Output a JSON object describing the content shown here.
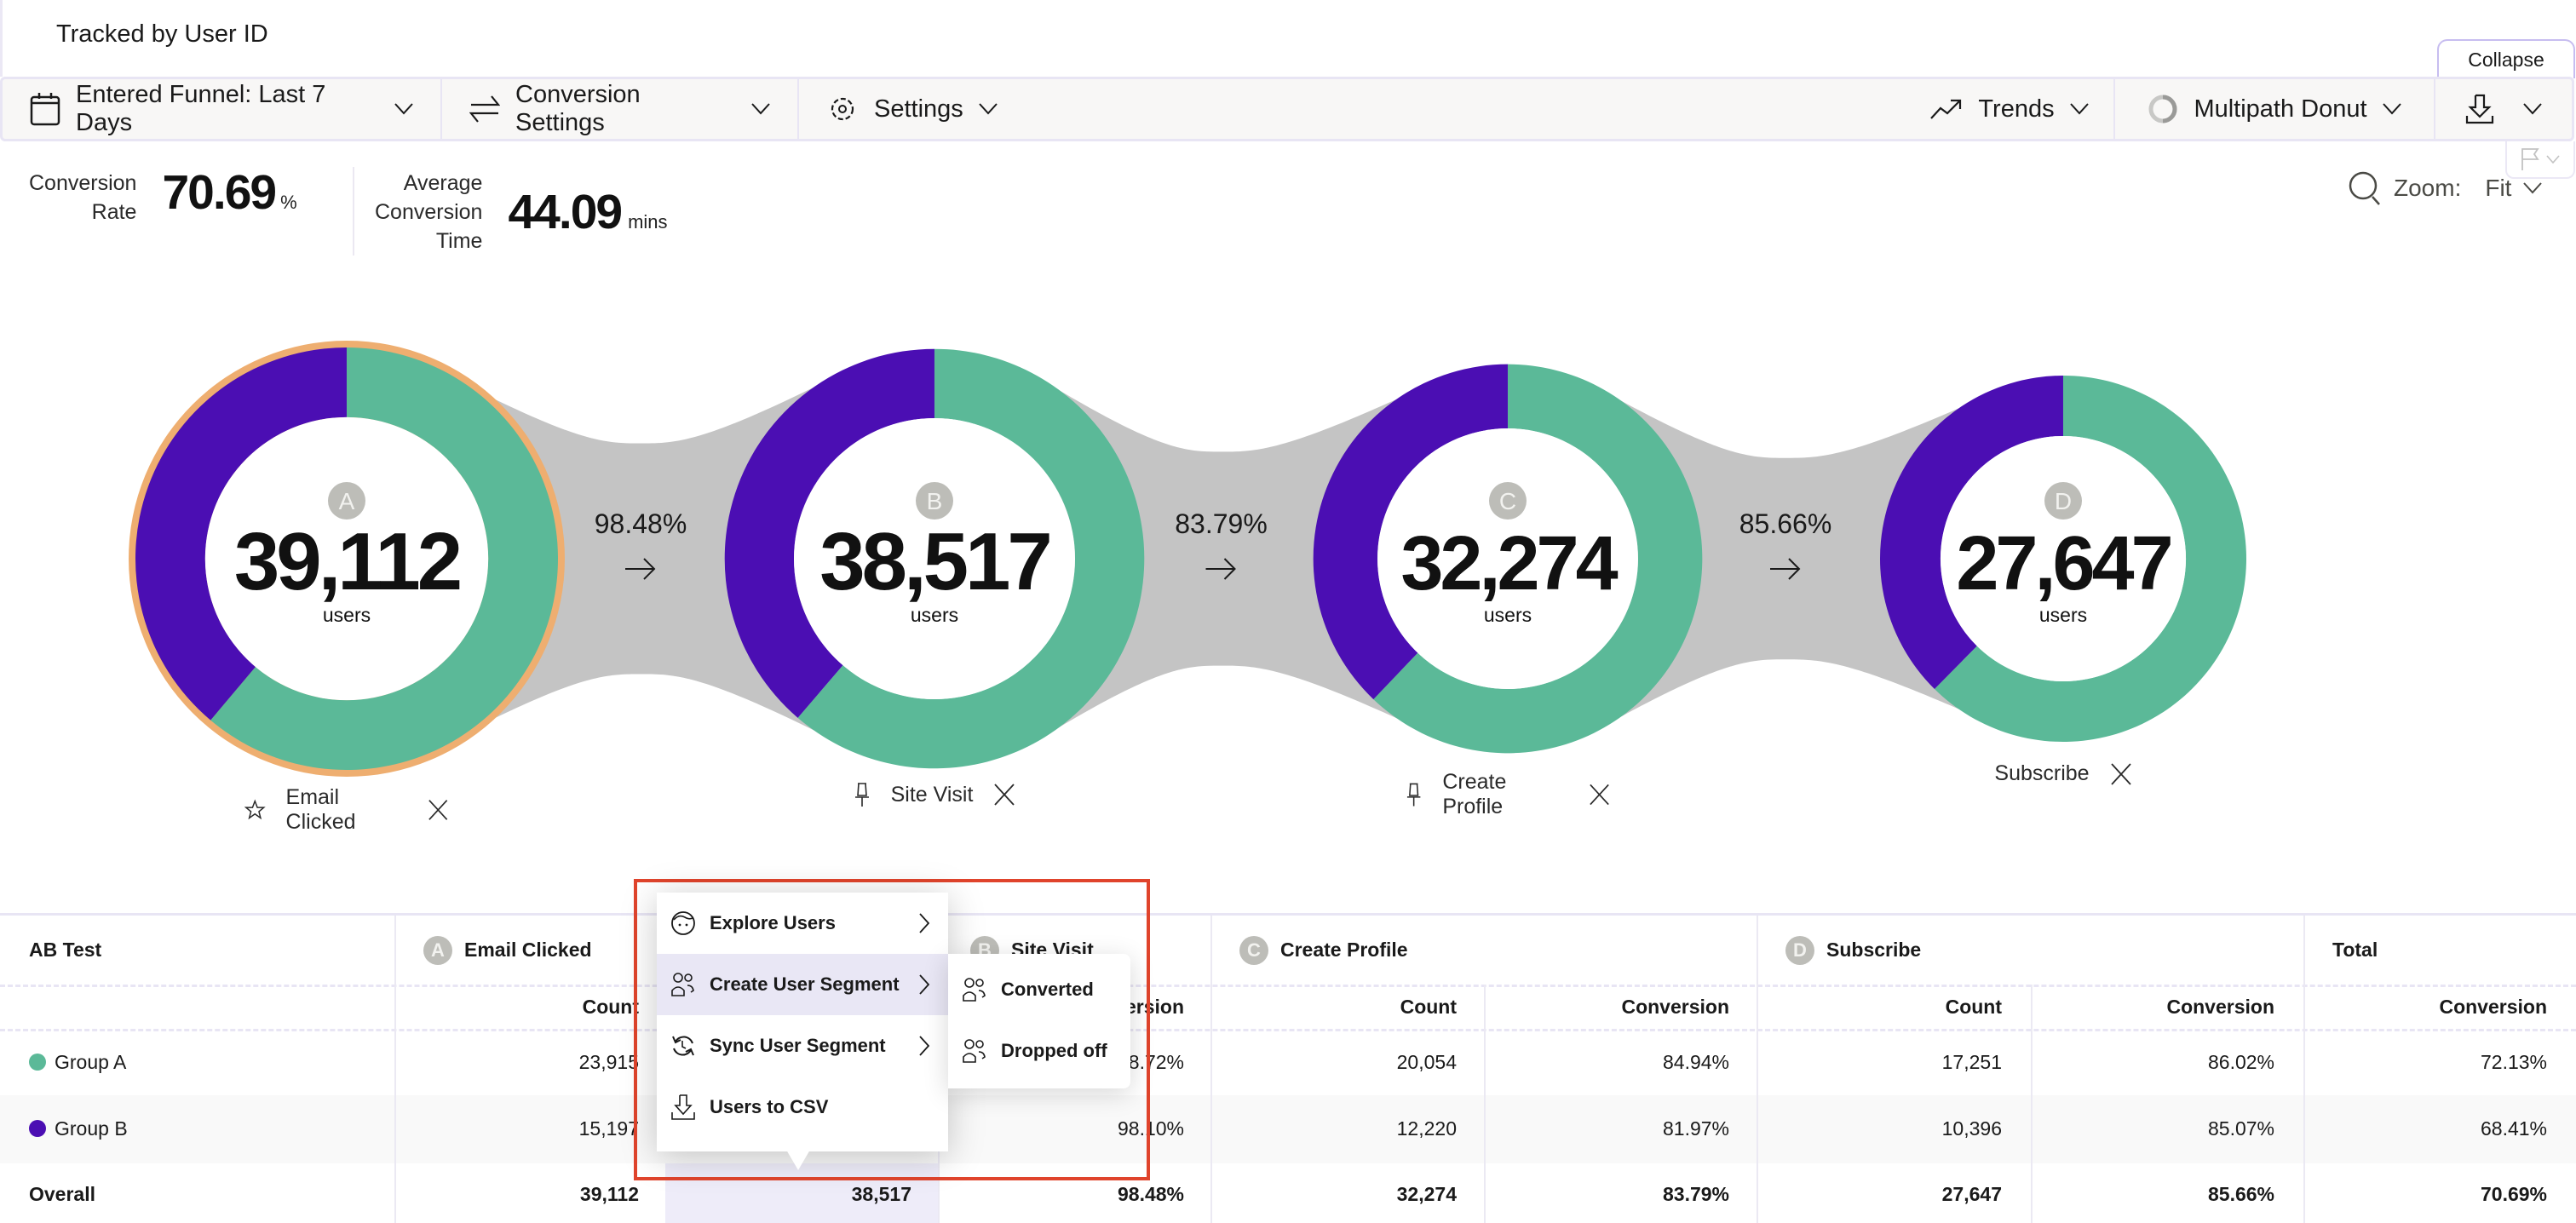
{
  "header": {
    "title": "Tracked by User ID",
    "collapse_label": "Collapse"
  },
  "toolbar": {
    "date_range": "Entered Funnel: Last 7 Days",
    "conversion_settings": "Conversion Settings",
    "settings": "Settings",
    "trends": "Trends",
    "chart_type": "Multipath Donut"
  },
  "stats": {
    "conversion_rate_label_1": "Conversion",
    "conversion_rate_label_2": "Rate",
    "conversion_rate_value": "70.69",
    "conversion_rate_unit": "%",
    "avg_time_label_1": "Average",
    "avg_time_label_2": "Conversion",
    "avg_time_label_3": "Time",
    "avg_time_value": "44.09",
    "avg_time_unit": "mins"
  },
  "zoom": {
    "label": "Zoom:",
    "value": "Fit"
  },
  "colors": {
    "group_a": "#5bb998",
    "group_b": "#4b0eb3",
    "selected_ring": "#eeae70",
    "flow": "#c4c4c4",
    "badge": "#bdbdb8",
    "highlight_box": "#e0442c"
  },
  "chart_data": {
    "type": "donut-funnel",
    "unit_label": "users",
    "steps": [
      {
        "badge": "A",
        "name": "Email Clicked",
        "total": "39,112",
        "group_a": 23915,
        "group_b": 15197,
        "pin_icon": "star",
        "selected": true
      },
      {
        "badge": "B",
        "name": "Site Visit",
        "total": "38,517",
        "group_a": 23609,
        "group_b": 14908,
        "pin_icon": "pin",
        "selected": false
      },
      {
        "badge": "C",
        "name": "Create Profile",
        "total": "32,274",
        "group_a": 20054,
        "group_b": 12220,
        "pin_icon": "pin",
        "selected": false
      },
      {
        "badge": "D",
        "name": "Subscribe",
        "total": "27,647",
        "group_a": 17251,
        "group_b": 10396,
        "pin_icon": "",
        "selected": false
      }
    ],
    "transitions": [
      "98.48%",
      "83.79%",
      "85.66%"
    ]
  },
  "table": {
    "first_col_header": "AB Test",
    "total_header": "Total",
    "steps": [
      {
        "badge": "A",
        "name": "Email Clicked"
      },
      {
        "badge": "B",
        "name": "Site Visit"
      },
      {
        "badge": "C",
        "name": "Create Profile"
      },
      {
        "badge": "D",
        "name": "Subscribe"
      }
    ],
    "sub_headers": {
      "count": "Count",
      "conversion": "Conversion"
    },
    "rows": [
      {
        "label": "Group A",
        "color": "#5bb998",
        "cells": [
          "23,915",
          "",
          "98.72%",
          "20,054",
          "84.94%",
          "17,251",
          "86.02%",
          "72.13%"
        ]
      },
      {
        "label": "Group B",
        "color": "#4b0eb3",
        "cells": [
          "15,197",
          "",
          "98.10%",
          "12,220",
          "81.97%",
          "10,396",
          "85.07%",
          "68.41%"
        ]
      },
      {
        "label": "Overall",
        "color": "",
        "cells": [
          "39,112",
          "38,517",
          "98.48%",
          "32,274",
          "83.79%",
          "27,647",
          "85.66%",
          "70.69%"
        ]
      }
    ]
  },
  "context_menu": {
    "items": [
      {
        "label": "Explore Users",
        "icon": "face-icon",
        "has_submenu": true
      },
      {
        "label": "Create User Segment",
        "icon": "users-icon",
        "has_submenu": true,
        "active": true
      },
      {
        "label": "Sync User Segment",
        "icon": "sync-icon",
        "has_submenu": true
      },
      {
        "label": "Users to CSV",
        "icon": "download-icon",
        "has_submenu": false
      }
    ],
    "submenu": [
      {
        "label": "Converted",
        "icon": "users-icon"
      },
      {
        "label": "Dropped off",
        "icon": "users-icon"
      }
    ]
  }
}
